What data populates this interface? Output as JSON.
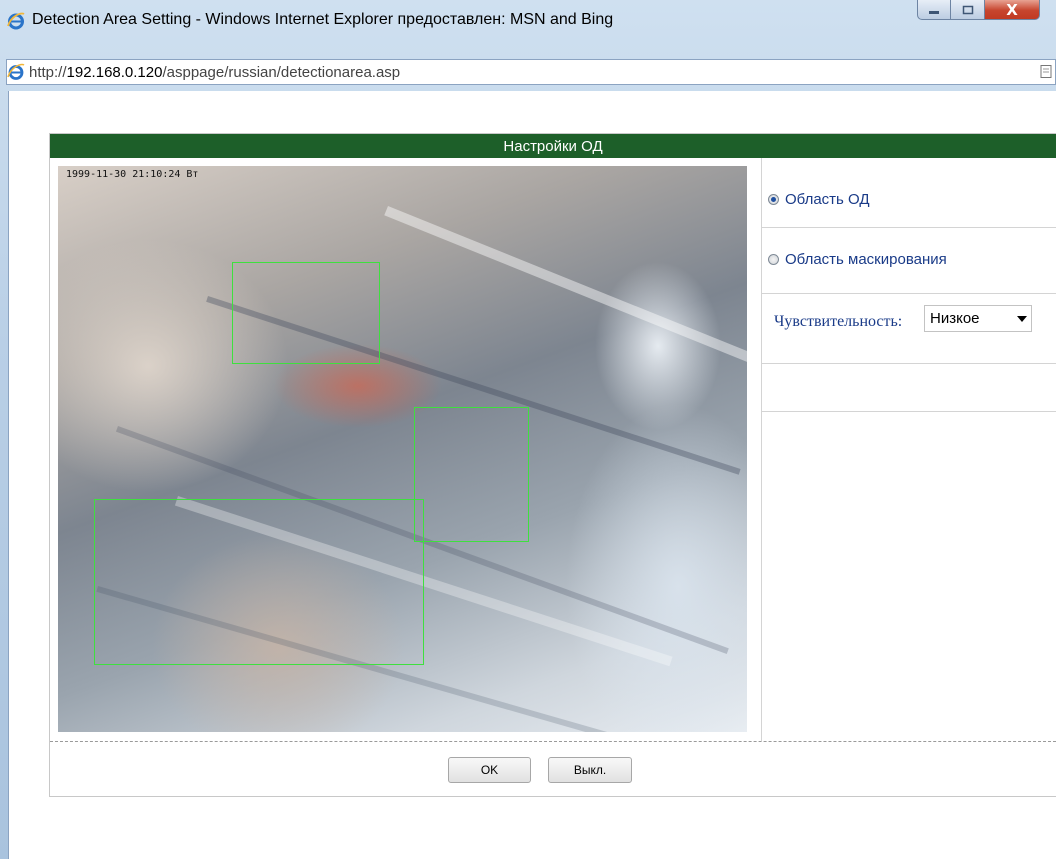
{
  "window": {
    "title": "Detection Area Setting - Windows Internet Explorer предоставлен: MSN and Bing",
    "close_glyph": "X"
  },
  "address": {
    "prefix": "http://",
    "host": "192.168.0.120",
    "path": "/asppage/russian/detectionarea.asp"
  },
  "panel": {
    "header": "Настройки ОД"
  },
  "video": {
    "timestamp": "1999-11-30 21:10:24 Вт",
    "boxes_color": "#3ee03e"
  },
  "sidebar": {
    "options": [
      {
        "label": "Область ОД",
        "selected": true
      },
      {
        "label": "Область маскирования",
        "selected": false
      }
    ],
    "sensitivity_label": "Чувствительность:",
    "sensitivity_value": "Низкое"
  },
  "buttons": {
    "ok": "OK",
    "off": "Выкл."
  },
  "colors": {
    "header_bg": "#1d5f29",
    "link_text": "#1a3b88"
  }
}
